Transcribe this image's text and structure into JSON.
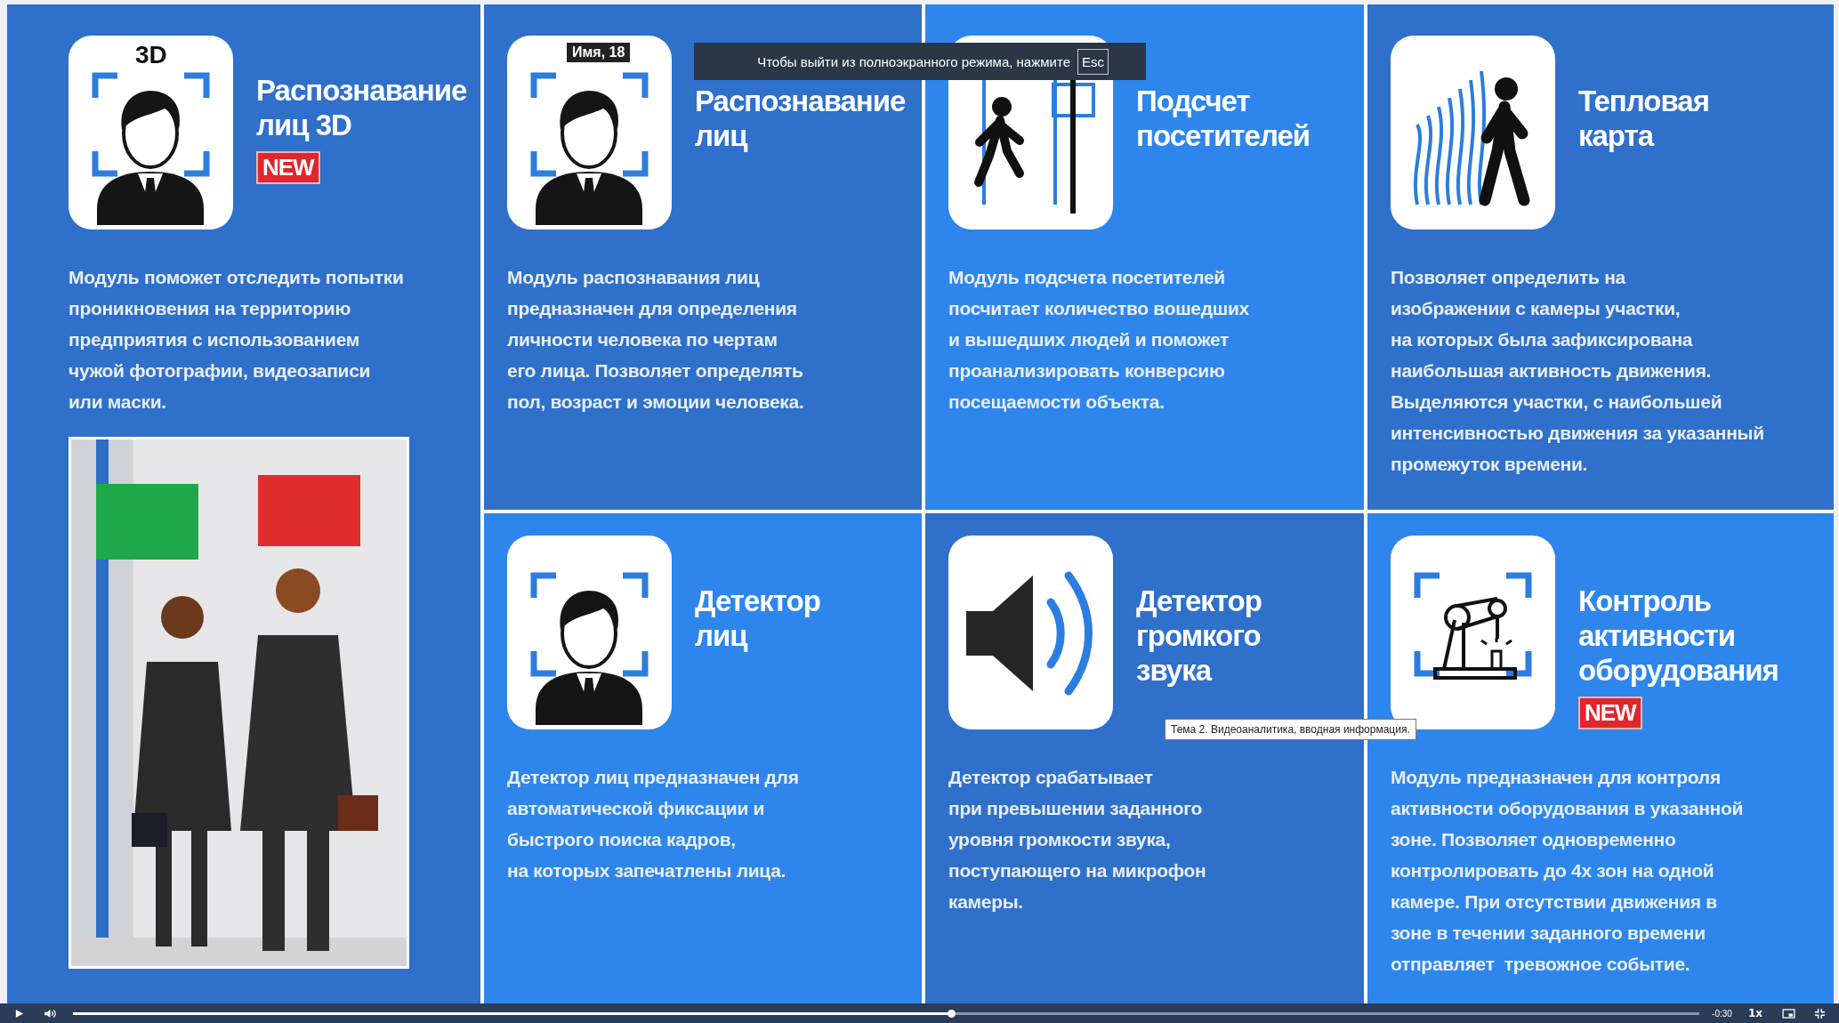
{
  "slide": {
    "panels": [
      {
        "kind": "tall",
        "icon_label": "3D",
        "color": "#2f70cb",
        "title": [
          "Распознавание",
          "лиц 3D"
        ],
        "badge": "NEW",
        "body": [
          "Модуль поможет отследить попытки",
          "проникновения на территорию",
          "предприятия с использованием",
          "чужой фотографии, видеозаписи",
          "или маски."
        ],
        "picture": {
          "kind": "picture"
        }
      },
      {
        "kind": "card",
        "icon_label": "Имя, 18",
        "color": "#2f70cb",
        "title": [
          "Распознавание",
          "лиц"
        ],
        "body": [
          "Модуль распознавания лиц",
          "предназначен для определения",
          "личности человека по чертам",
          "его лица. Позволяет определять",
          "пол, возраст и эмоции человека."
        ]
      },
      {
        "kind": "card",
        "color": "#2e86ec",
        "title": [
          "Подсчет",
          "посетителей"
        ],
        "body": [
          "Модуль подсчета посетителей",
          "посчитает количество вошедших",
          "и вышедших людей и поможет",
          "проанализировать конверсию",
          "посещаемости объекта."
        ]
      },
      {
        "kind": "card",
        "color": "#2f70cb",
        "title": [
          "Тепловая",
          "карта"
        ],
        "body": [
          "Позволяет определить на",
          "изображении с камеры участки,",
          "на которых была зафиксирована",
          "наибольшая активность движения.",
          "Выделяются участки, с наибольшей",
          "интенсивностью движения за указанный",
          "промежуток времени."
        ]
      },
      {
        "kind": "card",
        "color": "#2e86ec",
        "title": [
          "Детектор",
          "лиц"
        ],
        "body": [
          "Детектор лиц предназначен для",
          "автоматической фиксации и",
          "быстрого поиска кадров,",
          "на которых запечатлены лица."
        ]
      },
      {
        "kind": "card",
        "color": "#2f70cb",
        "title": [
          "Детектор",
          "громкого",
          "звука"
        ],
        "body": [
          "Детектор срабатывает",
          "при превышении заданного",
          "уровня громкости звука,",
          "поступающего на микрофон",
          "камеры."
        ]
      },
      {
        "kind": "card",
        "color": "#2e86ec",
        "title": [
          "Контроль",
          "активности",
          "оборудования"
        ],
        "badge": "NEW",
        "body": [
          "Модуль предназначен для контроля",
          "активности оборудования в указанной",
          "зоне. Позволяет одновременно",
          "контролировать до 4х зон на одной",
          "камере. При отсутствии движения в",
          "зоне в течении заданного времени",
          "отправляет  тревожное событие."
        ]
      }
    ]
  },
  "fullscreen_notice": {
    "text": "Чтобы выйти из полноэкранного режима, нажмите",
    "key": "Esc"
  },
  "tooltip": "Тема 2. Видеоаналитика, вводная информация.",
  "player": {
    "progress": {
      "level": 0.54
    },
    "time": "-0:30",
    "speed": "1x"
  }
}
